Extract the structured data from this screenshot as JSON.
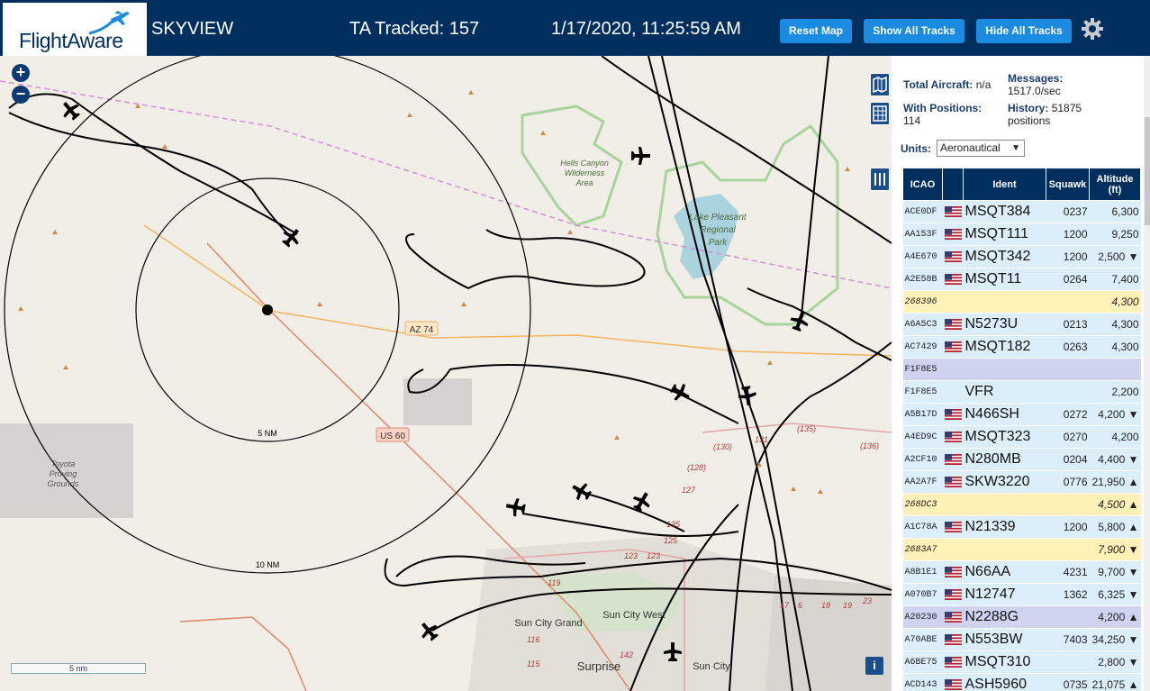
{
  "header": {
    "logo_text": "FlightAware",
    "site_name": "SKYVIEW",
    "tracked": "TA Tracked: 157",
    "datetime": "1/17/2020, 11:25:59 AM",
    "reset_label": "Reset Map",
    "show_all_label": "Show All Tracks",
    "hide_all_label": "Hide All Tracks"
  },
  "map": {
    "labels": {
      "az74": "AZ 74",
      "us60": "US 60",
      "ring5": "5 NM",
      "ring10": "10 NM",
      "hells1": "Hells Canyon",
      "hells2": "Wilderness",
      "hells3": "Area",
      "lake1": "Lake Pleasant",
      "lake2": "Regional",
      "lake3": "Park",
      "toyota1": "Toyota",
      "toyota2": "Proving",
      "toyota3": "Grounds",
      "suncitygrand": "Sun City Grand",
      "suncitywest": "Sun City West",
      "surprise": "Surprise",
      "suncity": "Sun City",
      "r135a": "(135)",
      "r130": "(130)",
      "r131": "131",
      "r136": "(136)",
      "r128": "(128)",
      "r127": "127",
      "r135b": "135",
      "r125": "125",
      "r123a": "123",
      "r123b": "123",
      "r119": "119",
      "r115": "115",
      "r116": "116",
      "r142": "142",
      "r17": "17",
      "r6": "6",
      "r18": "18",
      "r19": "19",
      "r23": "23"
    },
    "scale_label": "5 nm",
    "info_label": "i",
    "zoom_in": "+",
    "zoom_out": "−"
  },
  "panel": {
    "total_label": "Total Aircraft:",
    "total_value": "n/a",
    "messages_label": "Messages:",
    "messages_value": "1517.0/sec",
    "positions_label": "With Positions:",
    "positions_value": "114",
    "history_label": "History:",
    "history_value": "51875 positions",
    "units_label": "Units:",
    "units_value": "Aeronautical",
    "columns": {
      "icao": "ICAO",
      "ident": "Ident",
      "squawk": "Squawk",
      "altitude": "Altitude (ft)"
    },
    "rows": [
      {
        "icao": "ACE0DF",
        "flag": true,
        "ident": "MSQT384",
        "squawk": "0237",
        "altitude": "6,300",
        "style": "normal"
      },
      {
        "icao": "AA153F",
        "flag": true,
        "ident": "MSQT111",
        "squawk": "1200",
        "altitude": "9,250",
        "style": "normal"
      },
      {
        "icao": "A4E670",
        "flag": true,
        "ident": "MSQT342",
        "squawk": "1200",
        "altitude": "2,500 ▼",
        "style": "normal"
      },
      {
        "icao": "A2E58B",
        "flag": true,
        "ident": "MSQT11",
        "squawk": "0264",
        "altitude": "7,400",
        "style": "normal"
      },
      {
        "icao": "268396",
        "flag": false,
        "ident": "",
        "squawk": "",
        "altitude": "4,300",
        "style": "yellow"
      },
      {
        "icao": "A6A5C3",
        "flag": true,
        "ident": "N5273U",
        "squawk": "0213",
        "altitude": "4,300",
        "style": "normal"
      },
      {
        "icao": "AC7429",
        "flag": true,
        "ident": "MSQT182",
        "squawk": "0263",
        "altitude": "4,300",
        "style": "normal"
      },
      {
        "icao": "F1F8E5",
        "flag": false,
        "ident": "",
        "squawk": "",
        "altitude": "",
        "style": "purple"
      },
      {
        "icao": "F1F8E5",
        "flag": false,
        "ident": "VFR",
        "squawk": "",
        "altitude": "2,200",
        "style": "normal"
      },
      {
        "icao": "A5B17D",
        "flag": true,
        "ident": "N466SH",
        "squawk": "0272",
        "altitude": "4,200 ▼",
        "style": "normal"
      },
      {
        "icao": "A4ED9C",
        "flag": true,
        "ident": "MSQT323",
        "squawk": "0270",
        "altitude": "4,200",
        "style": "normal"
      },
      {
        "icao": "A2CF10",
        "flag": true,
        "ident": "N280MB",
        "squawk": "0204",
        "altitude": "4,400 ▼",
        "style": "normal"
      },
      {
        "icao": "AA2A7F",
        "flag": true,
        "ident": "SKW3220",
        "squawk": "0776",
        "altitude": "21,950 ▲",
        "style": "normal"
      },
      {
        "icao": "268DC3",
        "flag": false,
        "ident": "",
        "squawk": "",
        "altitude": "4,500 ▲",
        "style": "yellow"
      },
      {
        "icao": "A1C78A",
        "flag": true,
        "ident": "N21339",
        "squawk": "1200",
        "altitude": "5,800 ▲",
        "style": "normal"
      },
      {
        "icao": "2683A7",
        "flag": false,
        "ident": "",
        "squawk": "",
        "altitude": "7,900 ▼",
        "style": "yellow"
      },
      {
        "icao": "A8B1E1",
        "flag": true,
        "ident": "N66AA",
        "squawk": "4231",
        "altitude": "9,700 ▼",
        "style": "normal"
      },
      {
        "icao": "A070B7",
        "flag": true,
        "ident": "N12747",
        "squawk": "1362",
        "altitude": "6,325 ▼",
        "style": "normal"
      },
      {
        "icao": "A20230",
        "flag": true,
        "ident": "N2288G",
        "squawk": "",
        "altitude": "4,200 ▲",
        "style": "purple"
      },
      {
        "icao": "A70ABE",
        "flag": true,
        "ident": "N553BW",
        "squawk": "7403",
        "altitude": "34,250 ▼",
        "style": "normal"
      },
      {
        "icao": "A6BE75",
        "flag": true,
        "ident": "MSQT310",
        "squawk": "",
        "altitude": "2,800 ▼",
        "style": "normal"
      },
      {
        "icao": "ACD143",
        "flag": true,
        "ident": "ASH5960",
        "squawk": "0735",
        "altitude": "21,075 ▲",
        "style": "normal"
      }
    ]
  },
  "colors": {
    "header_bg": "#002f5d",
    "button_bg": "#1a8be0",
    "map_bg": "#f1eee8",
    "water": "#aad3df",
    "park_border": "#a8d49c",
    "row_normal": "#dbeef9",
    "row_yellow": "#fff2b8",
    "row_purple": "#cfd3f0"
  },
  "icons": [
    "flightaware-logo-plane-icon",
    "gear-icon",
    "zoom-in-icon",
    "zoom-out-icon",
    "map-layer-icon",
    "grid-icon",
    "columns-icon",
    "info-icon",
    "airplane-icon",
    "us-flag-icon"
  ]
}
